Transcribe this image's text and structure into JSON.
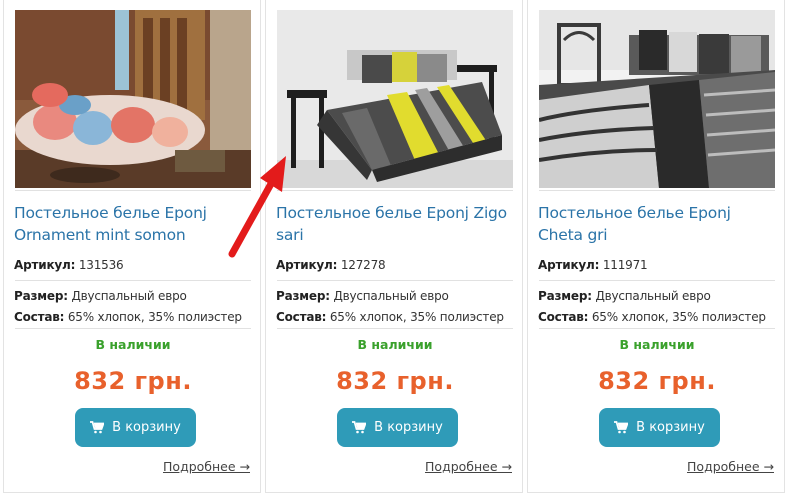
{
  "products": [
    {
      "title": "Постельное белье Eponj Ornament mint somon",
      "sku_label": "Артикул:",
      "sku": "131536",
      "size_label": "Размер:",
      "size": "Двуспальный евро",
      "comp_label": "Состав:",
      "composition": "65% хлопок, 35% полиэстер",
      "stock": "В наличии",
      "price": "832 грн.",
      "cart": "В корзину",
      "more": "Подробнее →",
      "image": "bedding-ornament-photo"
    },
    {
      "title": "Постельное белье Eponj Zigo sari",
      "sku_label": "Артикул:",
      "sku": "127278",
      "size_label": "Размер:",
      "size": "Двуспальный евро",
      "comp_label": "Состав:",
      "composition": "65% хлопок, 35% полиэстер",
      "stock": "В наличии",
      "price": "832 грн.",
      "cart": "В корзину",
      "more": "Подробнее →",
      "image": "bedding-zigo-photo"
    },
    {
      "title": "Постельное белье Eponj Cheta gri",
      "sku_label": "Артикул:",
      "sku": "111971",
      "size_label": "Размер:",
      "size": "Двуспальный евро",
      "comp_label": "Состав:",
      "composition": "65% хлопок, 35% полиэстер",
      "stock": "В наличии",
      "price": "832 грн.",
      "cart": "В корзину",
      "more": "Подробнее →",
      "image": "bedding-cheta-photo"
    }
  ],
  "colors": {
    "title_link": "#2b74a8",
    "in_stock": "#3aa12c",
    "price": "#e8612c",
    "button": "#2f9bb8",
    "annotation_arrow": "#e31b1b"
  }
}
